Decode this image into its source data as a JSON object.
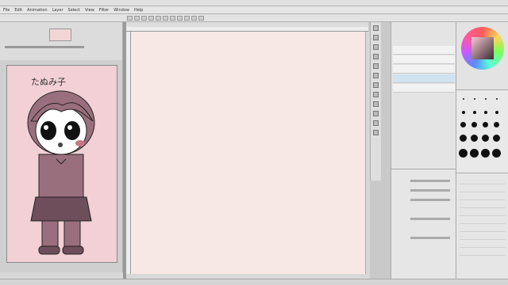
{
  "app": {
    "title": ""
  },
  "menu": [
    "File",
    "Edit",
    "Animation",
    "Layer",
    "Select",
    "View",
    "Filter",
    "Window",
    "Help"
  ],
  "tabs": [
    ""
  ],
  "layers": [
    {
      "name": ""
    },
    {
      "name": ""
    },
    {
      "name": ""
    },
    {
      "name": ""
    },
    {
      "name": ""
    }
  ],
  "subview": {
    "caption": "たぬみ子"
  },
  "colors": {
    "accent": "#4db8d0",
    "canvas": "#f7e7e5",
    "sub": "#f2d0d6"
  },
  "status": {
    "left": "",
    "mid": ""
  }
}
